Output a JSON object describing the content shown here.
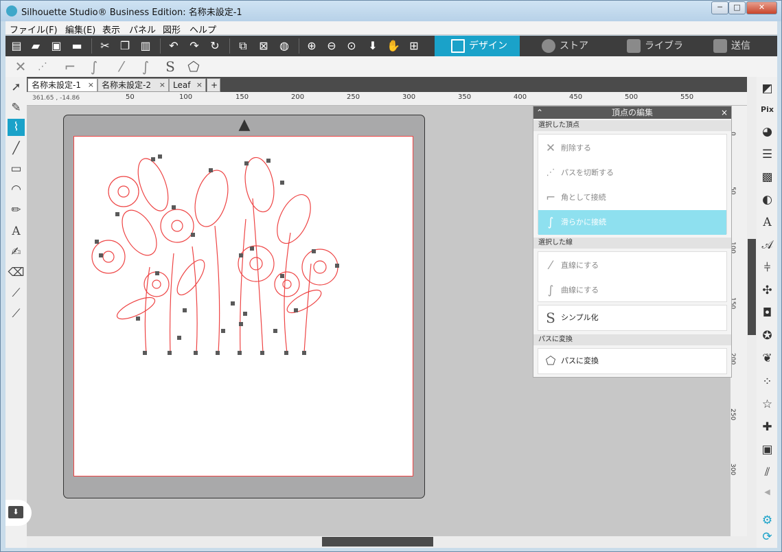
{
  "window": {
    "title": "Silhouette Studio® Business Edition: 名称未設定-1",
    "minimize": "─",
    "maximize": "□",
    "close": "✕"
  },
  "menu": [
    "ファイル(F)",
    "編集(E)",
    "表示",
    "パネル",
    "図形",
    "ヘルプ"
  ],
  "toolbar_icons": [
    "new-document-icon",
    "open-folder-icon",
    "save-icon",
    "print-icon",
    "cut-icon",
    "copy-icon",
    "paste-icon",
    "undo-icon",
    "redo-icon",
    "replicate-icon",
    "group-icon",
    "ungroup-icon",
    "fill-color-icon",
    "zoom-in-icon",
    "zoom-out-icon",
    "zoom-area-icon",
    "move-down-icon",
    "pan-hand-icon",
    "fit-page-icon"
  ],
  "nav_tabs": [
    {
      "label": "デザイン",
      "active": true
    },
    {
      "label": "ストア",
      "active": false
    },
    {
      "label": "ライブラリ",
      "active": false
    },
    {
      "label": "送信",
      "active": false
    }
  ],
  "doc_tabs": [
    {
      "label": "名称未設定-1",
      "close": "×",
      "active": true
    },
    {
      "label": "名称未設定-2",
      "close": "×",
      "active": false
    },
    {
      "label": "Leaf",
      "close": "×",
      "active": false
    }
  ],
  "add_tab": "+",
  "coords": "361.65 , -14.86",
  "ruler_h": [
    "50",
    "100",
    "150",
    "200",
    "250",
    "300",
    "350",
    "400",
    "450",
    "500",
    "550"
  ],
  "ruler_v": [
    "0",
    "50",
    "100",
    "150",
    "200",
    "250",
    "300"
  ],
  "panel": {
    "title": "頂点の編集",
    "collapse": "⌃",
    "close": "×",
    "section_points": "選択した頂点",
    "delete": "削除する",
    "break_path": "パスを切断する",
    "corner": "角として接続",
    "smooth": "滑らかに接続",
    "section_lines": "選択した線",
    "straighten": "直線にする",
    "curve": "曲線にする",
    "simplify": "シンプル化",
    "section_convert": "パスに変換",
    "convert": "パスに変換"
  },
  "colors": {
    "accent": "#1aa2c9",
    "cut_line": "#e44444",
    "toolbar": "#3d3d3d"
  }
}
